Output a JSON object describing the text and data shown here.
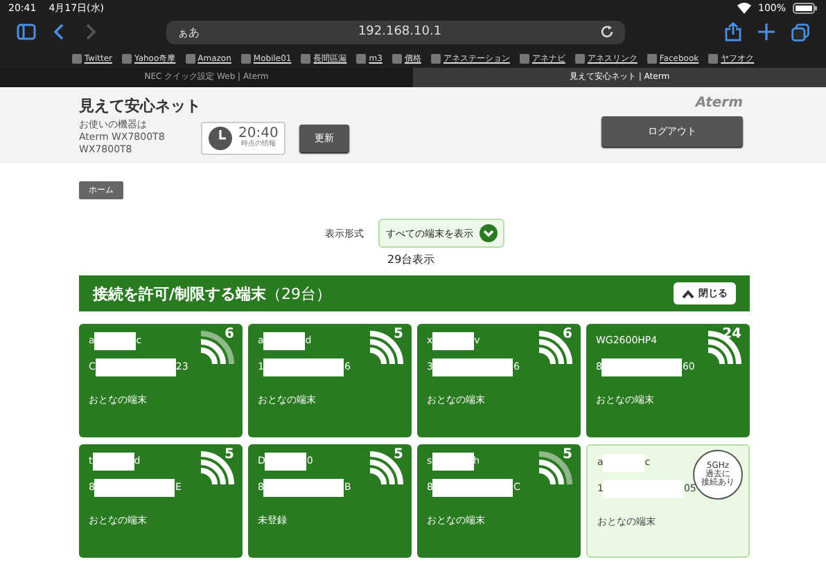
{
  "status_bar": {
    "time": "20:41",
    "date": "4月17日(水)",
    "battery": "100%"
  },
  "browser": {
    "text_size": "ぁあ",
    "address": "192.168.10.1",
    "bookmarks": [
      "Twitter",
      "Yahoo奇摩",
      "Amazon",
      "Mobile01",
      "長間區漏",
      "m3",
      "價格",
      "アネステーション",
      "アネナビ",
      "アネスリンク",
      "Facebook",
      "ヤフオク"
    ],
    "tabs": [
      {
        "title": "NEC クイック設定 Web | Aterm",
        "selected": false
      },
      {
        "title": "見えて安心ネット | Aterm",
        "selected": true
      }
    ]
  },
  "header": {
    "title": "見えて安心ネット",
    "device_caption": "お使いの機器は",
    "device_model": "Aterm WX7800T8",
    "device_model_2": "WX7800T8",
    "clock_time": "20:40",
    "clock_caption": "時点の情報",
    "refresh_button": "更新",
    "logo": "Aterm",
    "logout_button": "ログアウト"
  },
  "home_button": "ホーム",
  "display_format": {
    "label": "表示形式",
    "value": "すべての端末を表示",
    "count": "29台表示"
  },
  "section": {
    "title": "接続を許可/制限する端末",
    "count": "（29台）",
    "close_button": "閉じる"
  },
  "cards": [
    {
      "kind": "online",
      "name": [
        "a",
        "c"
      ],
      "address": [
        "C",
        "23"
      ],
      "band": "6",
      "outer_arc_dim": true,
      "label": "おとなの端末"
    },
    {
      "kind": "online",
      "name": [
        "a",
        "d"
      ],
      "address": [
        "1",
        "6"
      ],
      "band": "5",
      "outer_arc_dim": false,
      "label": "おとなの端末"
    },
    {
      "kind": "online",
      "name": [
        "x",
        "v"
      ],
      "address": [
        "3",
        "6"
      ],
      "band": "6",
      "outer_arc_dim": false,
      "label": "おとなの端末"
    },
    {
      "kind": "online",
      "name": [
        "WG2600HP4"
      ],
      "address": [
        "8",
        "60"
      ],
      "band": "24",
      "outer_arc_dim": false,
      "label": "おとなの端末"
    },
    {
      "kind": "online",
      "name": [
        "t",
        "d"
      ],
      "address": [
        "8",
        "E"
      ],
      "band": "5",
      "outer_arc_dim": false,
      "label": "おとなの端末"
    },
    {
      "kind": "online",
      "name": [
        "D",
        "0"
      ],
      "address": [
        "8",
        "B"
      ],
      "band": "5",
      "outer_arc_dim": false,
      "label": "未登録"
    },
    {
      "kind": "online",
      "name": [
        "s",
        "h"
      ],
      "address": [
        "8",
        "C"
      ],
      "band": "5",
      "outer_arc_dim": true,
      "label": "おとなの端末"
    },
    {
      "kind": "past",
      "name": [
        "a",
        "c"
      ],
      "address": [
        "1",
        "05"
      ],
      "badge": [
        "5GHz",
        "過去に",
        "接続あり"
      ],
      "label": "おとなの端末"
    }
  ]
}
